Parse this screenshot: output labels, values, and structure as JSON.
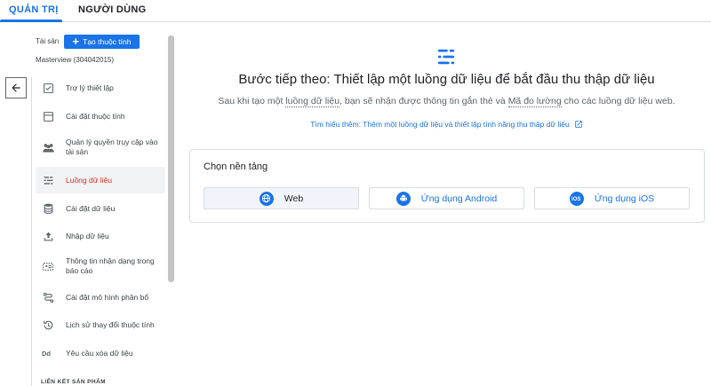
{
  "tabs": [
    {
      "label": "QUẢN TRỊ"
    },
    {
      "label": "NGƯỜI DÙNG"
    }
  ],
  "sidebar": {
    "asset_label": "Tài sản",
    "create_property": "Tạo thuộc tính",
    "property_name": "Masterview (304042015)",
    "items": [
      {
        "label": "Trợ lý thiết lập",
        "icon": "checklist-icon"
      },
      {
        "label": "Cài đặt thuộc tính",
        "icon": "property-settings-icon"
      },
      {
        "label": "Quản lý quyền truy cập vào tài sản",
        "icon": "people-icon"
      },
      {
        "label": "Luồng dữ liệu",
        "icon": "data-stream-icon"
      },
      {
        "label": "Cài đặt dữ liệu",
        "icon": "database-icon"
      },
      {
        "label": "Nhập dữ liệu",
        "icon": "upload-icon"
      },
      {
        "label": "Thông tin nhận dạng trong báo cáo",
        "icon": "reporting-identity-icon"
      },
      {
        "label": "Cài đặt mô hình phân bổ",
        "icon": "attribution-icon"
      },
      {
        "label": "Lịch sử thay đổi thuộc tính",
        "icon": "history-icon"
      },
      {
        "label": "Yêu cầu xóa dữ liệu",
        "icon": "data-deletion-icon"
      }
    ],
    "section_heading": "LIÊN KẾT SẢN PHẨM"
  },
  "main": {
    "heading": "Bước tiếp theo: Thiết lập một luồng dữ liệu để bắt đầu thu thập dữ liệu",
    "subtitle_prefix": "Sau khi tạo một ",
    "subtitle_term1": "luồng dữ liệu",
    "subtitle_mid": ", bạn sẽ nhận được thông tin gắn thẻ và ",
    "subtitle_term2": "Mã đo lường",
    "subtitle_suffix": " cho các luồng dữ liệu web.",
    "learn_more": "Tìm hiểu thêm: Thêm một luồng dữ liệu và thiết lập tính năng thu thập dữ liệu",
    "platform_title": "Chọn nền tảng",
    "platforms": [
      {
        "label": "Web",
        "icon": "globe-icon"
      },
      {
        "label": "Ứng dụng Android",
        "icon": "android-icon"
      },
      {
        "label": "Ứng dụng iOS",
        "icon": "ios-icon"
      }
    ]
  },
  "colors": {
    "accent": "#1a73e8",
    "active_nav_text": "#d93025",
    "active_nav_bg": "#f1f3f4"
  }
}
